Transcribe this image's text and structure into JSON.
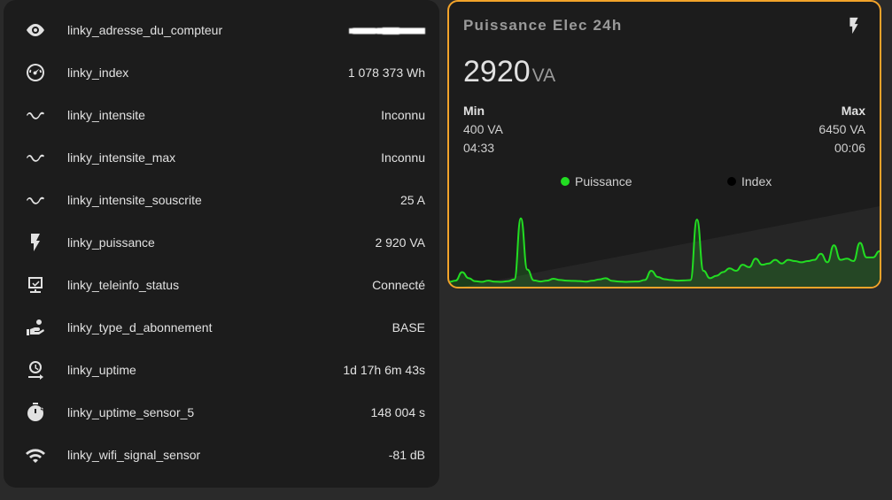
{
  "entities": [
    {
      "name": "linky_adresse_du_compteur",
      "value": "",
      "icon": "eye-icon",
      "redacted": true
    },
    {
      "name": "linky_index",
      "value": "1 078 373 Wh",
      "icon": "gauge-icon"
    },
    {
      "name": "linky_intensite",
      "value": "Inconnu",
      "icon": "sine-wave-icon"
    },
    {
      "name": "linky_intensite_max",
      "value": "Inconnu",
      "icon": "sine-wave-icon"
    },
    {
      "name": "linky_intensite_souscrite",
      "value": "25 A",
      "icon": "sine-wave-icon"
    },
    {
      "name": "linky_puissance",
      "value": "2 920 VA",
      "icon": "flash-icon"
    },
    {
      "name": "linky_teleinfo_status",
      "value": "Connecté",
      "icon": "monitor-check-icon"
    },
    {
      "name": "linky_type_d_abonnement",
      "value": "BASE",
      "icon": "hand-coin-icon"
    },
    {
      "name": "linky_uptime",
      "value": "1d 17h 6m 43s",
      "icon": "clock-arrow-icon"
    },
    {
      "name": "linky_uptime_sensor_5",
      "value": "148 004 s",
      "icon": "timer-icon"
    },
    {
      "name": "linky_wifi_signal_sensor",
      "value": "-81 dB",
      "icon": "wifi-icon"
    }
  ],
  "graph": {
    "title": "Puissance Elec 24h",
    "icon": "flash-icon",
    "value": "2920",
    "unit": "VA",
    "min": {
      "label": "Min",
      "value": "400 VA",
      "time": "04:33"
    },
    "max": {
      "label": "Max",
      "value": "6450 VA",
      "time": "00:06"
    },
    "accent_color": "#f2a32a",
    "legend": [
      {
        "name": "Puissance",
        "color": "#22dd22"
      },
      {
        "name": "Index",
        "color": "#000000"
      }
    ]
  },
  "chart_data": {
    "type": "line",
    "series": [
      {
        "name": "Puissance",
        "color": "#22dd22",
        "values": [
          400,
          500,
          1200,
          700,
          450,
          400,
          500,
          420,
          400,
          450,
          600,
          5600,
          1400,
          520,
          430,
          500,
          650,
          550,
          500,
          480,
          460,
          420,
          500,
          600,
          700,
          480,
          430,
          400,
          420,
          430,
          550,
          1300,
          800,
          620,
          550,
          500,
          520,
          540,
          5500,
          1300,
          700,
          900,
          1200,
          1500,
          1300,
          1800,
          1600,
          2300,
          1800,
          1900,
          2200,
          1900,
          2200,
          2100,
          2000,
          2100,
          2200,
          2700,
          2000,
          3400,
          2200,
          2300,
          2100,
          3600,
          2400,
          2400,
          2920
        ]
      },
      {
        "name": "Index",
        "color": "#000000",
        "values": []
      }
    ]
  }
}
